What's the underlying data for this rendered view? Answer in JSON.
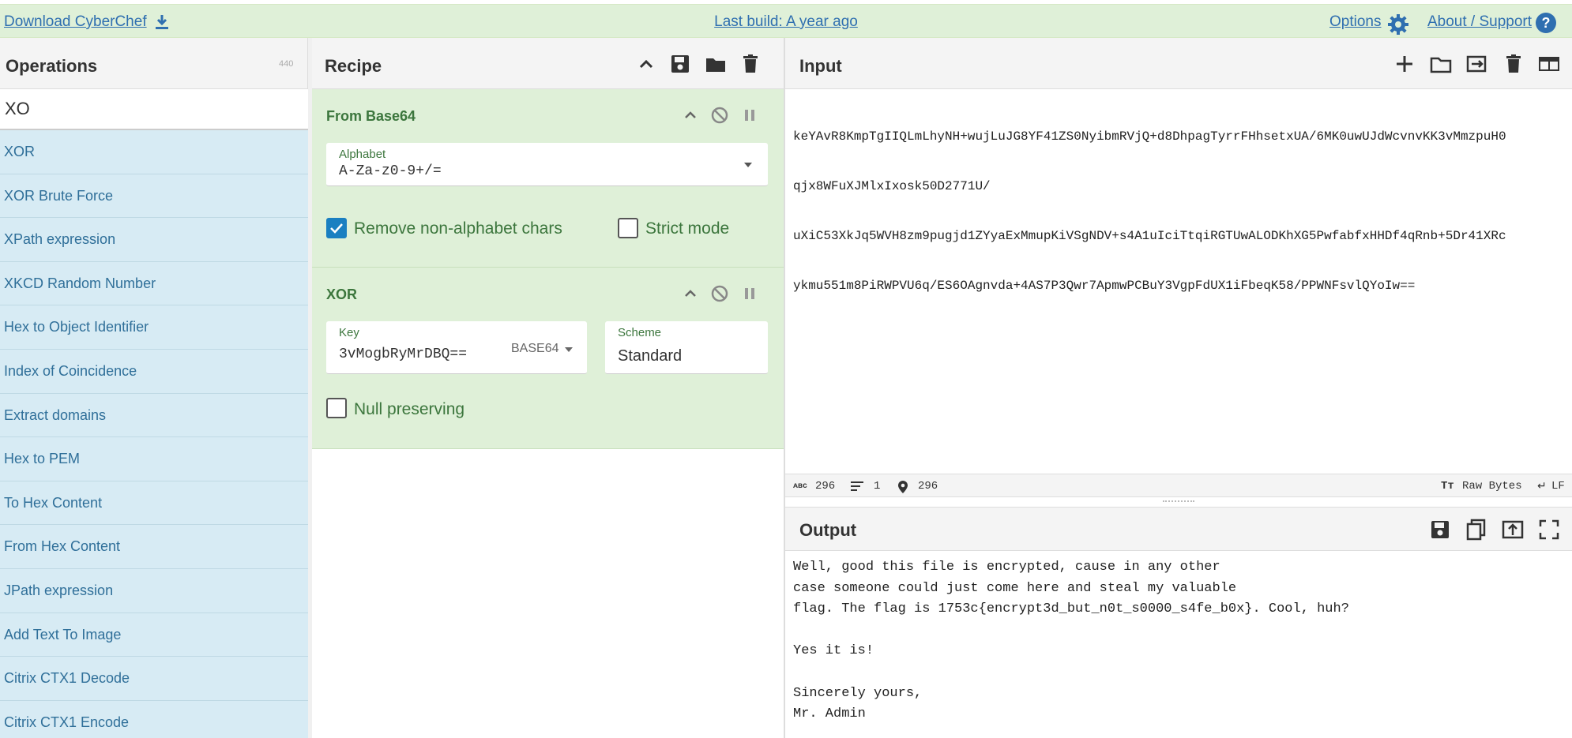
{
  "banner": {
    "download_label": "Download CyberChef",
    "build_label": "Last build: A year ago",
    "options_label": "Options",
    "about_label": "About / Support"
  },
  "operations": {
    "title": "Operations",
    "count": "440",
    "search_value": "XO",
    "items": [
      {
        "label": "XOR"
      },
      {
        "label": "XOR Brute Force"
      },
      {
        "label": "XPath expression"
      },
      {
        "label": "XKCD Random Number"
      },
      {
        "label": "Hex to Object Identifier"
      },
      {
        "label": "Index of Coincidence"
      },
      {
        "label": "Extract domains"
      },
      {
        "label": "Hex to PEM"
      },
      {
        "label": "To Hex Content"
      },
      {
        "label": "From Hex Content"
      },
      {
        "label": "JPath expression"
      },
      {
        "label": "Add Text To Image"
      },
      {
        "label": "Citrix CTX1 Decode"
      },
      {
        "label": "Citrix CTX1 Encode"
      }
    ]
  },
  "recipe": {
    "title": "Recipe",
    "ops": [
      {
        "name": "From Base64",
        "alphabet_label": "Alphabet",
        "alphabet_value": "A-Za-z0-9+/=",
        "remove_label": "Remove non-alphabet chars",
        "remove_checked": true,
        "strict_label": "Strict mode",
        "strict_checked": false
      },
      {
        "name": "XOR",
        "key_label": "Key",
        "key_value": "3vMogbRyMrDBQ==",
        "key_format": "BASE64",
        "scheme_label": "Scheme",
        "scheme_value": "Standard",
        "null_label": "Null preserving",
        "null_checked": false
      }
    ]
  },
  "input": {
    "title": "Input",
    "lines": [
      "keYAvR8KmpTgIIQLmLhyNH+wujLuJG8YF41ZS0NyibmRVjQ+d8DhpagTyrrFHhsetxUA/6MK0uwUJdWcvnvKK3vMmzpuH0",
      "qjx8WFuXJMlxIxosk50D2771U/",
      "uXiC53XkJq5WVH8zm9pugjd1ZYyaExMmupKiVSgNDV+s4A1uIciTtqiRGTUwALODKhXG5PwfabfxHHDf4qRnb+5Dr41XRc",
      "ykmu551m8PiRWPVU6q/ES6OAgnvda+4AS7P3Qwr7ApmwPCBuY3VgpFdUX1iFbeqK58/PPWNFsvlQYoIw=="
    ],
    "status": {
      "chars": "296",
      "lines": "1",
      "position": "296",
      "encoding": "Raw Bytes",
      "eol": "LF"
    }
  },
  "output": {
    "title": "Output",
    "text": "Well, good this file is encrypted, cause in any other\ncase someone could just come here and steal my valuable\nflag. The flag is 1753c{encrypt3d_but_n0t_s0000_s4fe_b0x}. Cool, huh?\n\nYes it is!\n\nSincerely yours,\nMr. Admin"
  },
  "colors": {
    "banner_bg": "#dff0d8",
    "link": "#2f6fb0",
    "op_bg": "#d7ebf4",
    "recipe_bg": "#dff0d8",
    "recipe_text": "#3c763d",
    "checkbox_on": "#1a7fc1"
  }
}
